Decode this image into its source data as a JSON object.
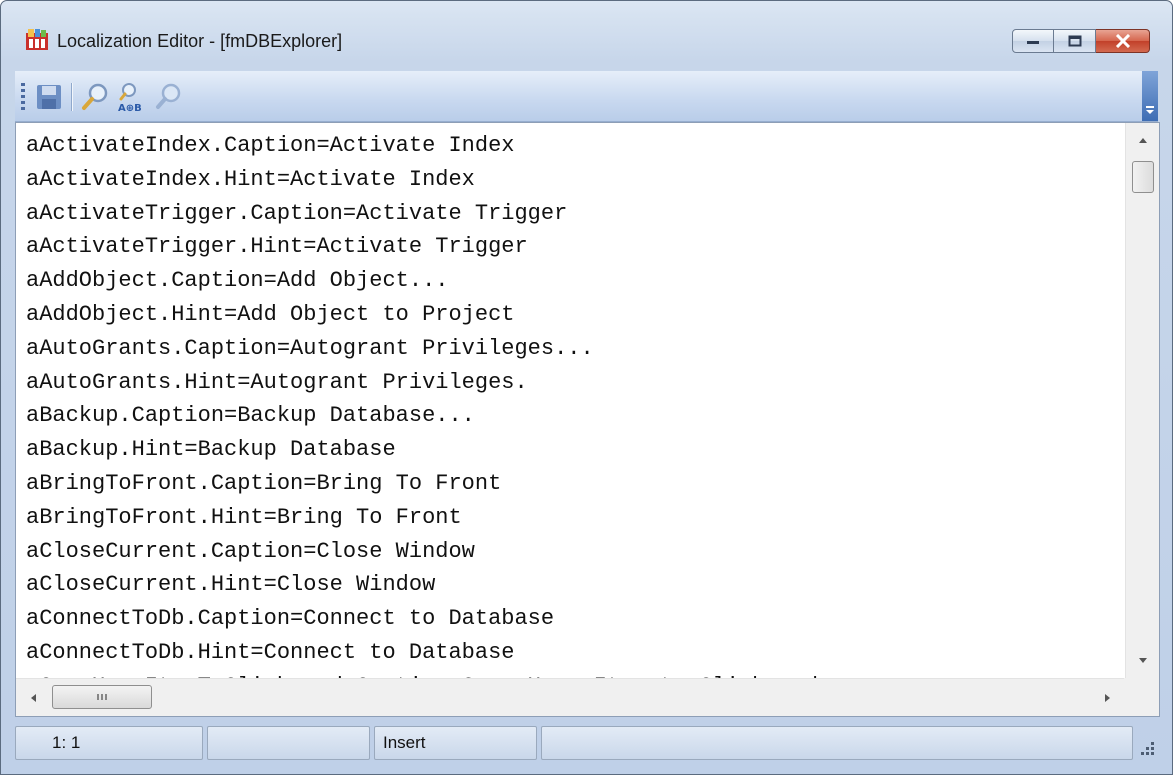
{
  "window": {
    "title": "Localization Editor - [fmDBExplorer]"
  },
  "toolbar": {
    "buttons": [
      {
        "icon": "save-icon"
      },
      {
        "icon": "find-icon"
      },
      {
        "icon": "find-replace-icon",
        "label": "A⊕B"
      },
      {
        "icon": "find-next-icon"
      }
    ]
  },
  "editor": {
    "lines": [
      "aActivateIndex.Caption=Activate Index",
      "aActivateIndex.Hint=Activate Index",
      "aActivateTrigger.Caption=Activate Trigger",
      "aActivateTrigger.Hint=Activate Trigger",
      "aAddObject.Caption=Add Object...",
      "aAddObject.Hint=Add Object to Project",
      "aAutoGrants.Caption=Autogrant Privileges...",
      "aAutoGrants.Hint=Autogrant Privileges.",
      "aBackup.Caption=Backup Database...",
      "aBackup.Hint=Backup Database",
      "aBringToFront.Caption=Bring To Front",
      "aBringToFront.Hint=Bring To Front",
      "aCloseCurrent.Caption=Close Window",
      "aCloseCurrent.Hint=Close Window",
      "aConnectToDb.Caption=Connect to Database",
      "aConnectToDb.Hint=Connect to Database",
      "aCopyUserItemToClipboard.Caption=Copy User Item to Clipboard"
    ]
  },
  "statusbar": {
    "position": "1:  1",
    "panel2": "",
    "mode": "Insert",
    "panel4": ""
  },
  "colors": {
    "close_button": "#c2402a",
    "toolbar_gradient_top": "#e6eef9",
    "toolbar_gradient_bottom": "#b9cde9"
  }
}
